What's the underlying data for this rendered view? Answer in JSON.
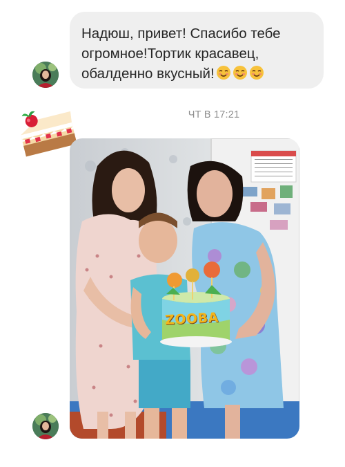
{
  "message": {
    "lines": [
      "Надюш, привет! Спасибо тебе",
      "огромное!Тортик красавец,",
      "обалденно вкусный!"
    ],
    "emoji": [
      "smiling-face-with-smiling-eyes-icon",
      "smiling-face-with-smiling-eyes-icon",
      "smiling-face-with-smiling-eyes-icon"
    ]
  },
  "sticker": {
    "icon": "cake-sticker-icon"
  },
  "timestamp": "ЧТ В 17:21",
  "photo": {
    "cake_brand": "ZOOBA"
  },
  "colors": {
    "bubble": "#efefef",
    "text": "#262626",
    "timestamp": "#8e8e8e"
  }
}
